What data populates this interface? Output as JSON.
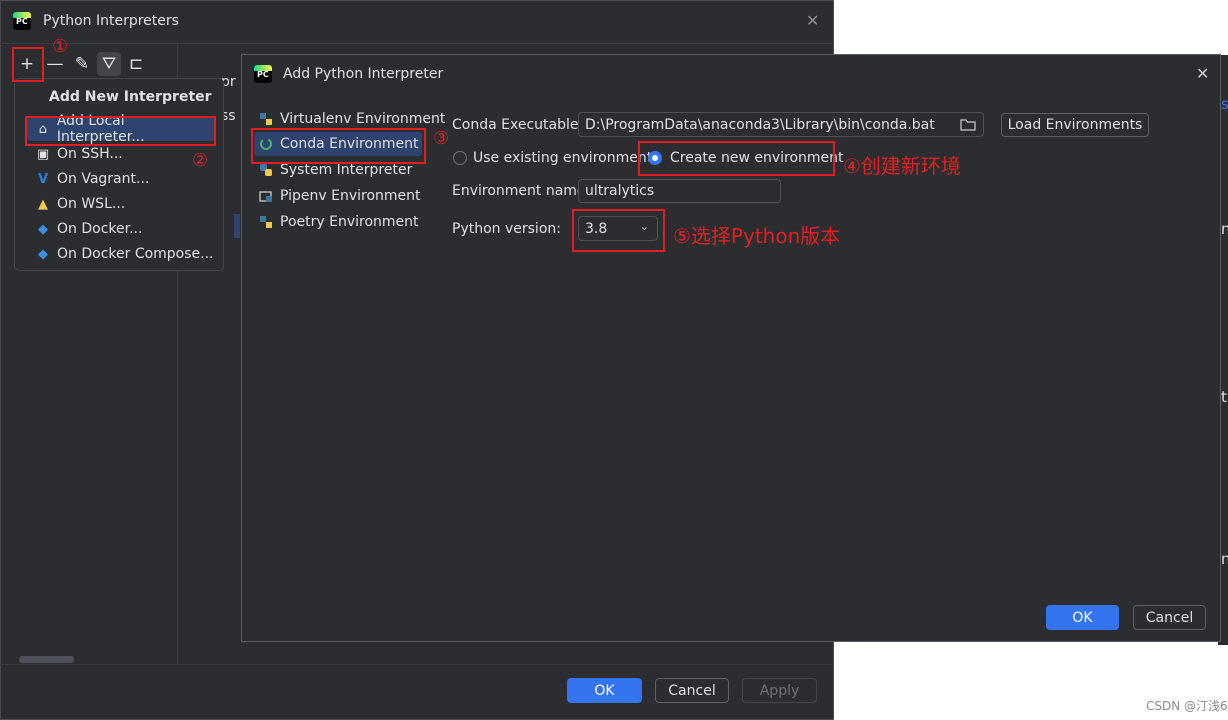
{
  "back_window": {
    "title": "Python Interpreters",
    "logo_text": "PC",
    "toolbar": {
      "add_label": "+",
      "remove_label": "—",
      "edit_label": "✎",
      "filter_label": "⛛",
      "tree_label": "⊏"
    },
    "left_partial_1": "pr",
    "left_partial_2": "ss",
    "buttons": {
      "ok": "OK",
      "cancel": "Cancel",
      "apply": "Apply"
    }
  },
  "popup": {
    "title": "Add New Interpreter",
    "items": [
      {
        "label": "Add Local Interpreter...",
        "icon": "home-icon",
        "glyph": "⌂"
      },
      {
        "label": "On SSH...",
        "icon": "terminal-icon",
        "glyph": "▣"
      },
      {
        "label": "On Vagrant...",
        "icon": "vagrant-icon",
        "glyph": "V"
      },
      {
        "label": "On WSL...",
        "icon": "linux-icon",
        "glyph": "▲"
      },
      {
        "label": "On Docker...",
        "icon": "docker-icon",
        "glyph": "◆"
      },
      {
        "label": "On Docker Compose...",
        "icon": "docker-compose-icon",
        "glyph": "◆"
      }
    ]
  },
  "dialog": {
    "title": "Add Python Interpreter",
    "logo_text": "PC",
    "nav": [
      {
        "label": "Virtualenv Environment",
        "icon": "virtualenv-icon"
      },
      {
        "label": "Conda Environment",
        "icon": "conda-icon"
      },
      {
        "label": "System Interpreter",
        "icon": "python-icon"
      },
      {
        "label": "Pipenv Environment",
        "icon": "pipenv-icon"
      },
      {
        "label": "Poetry Environment",
        "icon": "poetry-icon"
      }
    ],
    "conda_executable_label": "Conda Executable:",
    "conda_executable_value": "D:\\ProgramData\\anaconda3\\Library\\bin\\conda.bat",
    "load_environments": "Load Environments",
    "use_existing": "Use existing environment",
    "create_new": "Create new environment",
    "create_new_selected": true,
    "env_name_label": "Environment name:",
    "env_name_value": "ultralytics",
    "python_version_label": "Python version:",
    "python_version_value": "3.8",
    "ok": "OK",
    "cancel": "Cancel"
  },
  "annotations": {
    "n1": "①",
    "n2": "②",
    "n3": "③",
    "n4": "④创建新环境",
    "n5": "⑤选择Python版本"
  },
  "right_partial": {
    "s": "s",
    "n1": "n",
    "t": "t",
    "n2": "n"
  },
  "watermark": "CSDN @汀浅6",
  "colors": {
    "accent": "#3574f0",
    "annotation_red": "#e02020",
    "bg_dark": "#2b2d30",
    "selection": "#2e436e"
  }
}
